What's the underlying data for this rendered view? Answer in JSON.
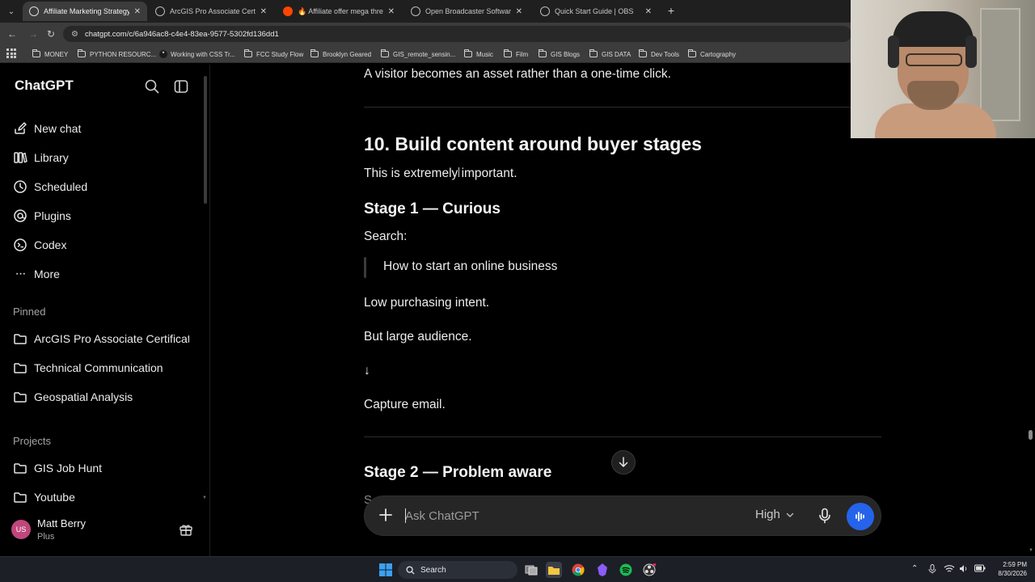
{
  "browser": {
    "tabs": [
      {
        "label": "Affiliate Marketing Strategy",
        "active": true,
        "favicon": "chatgpt-favicon"
      },
      {
        "label": "ArcGIS Pro Associate Certificatio",
        "active": false,
        "favicon": "chatgpt-favicon"
      },
      {
        "label": "🔥 Affiliate offer mega threa",
        "active": false,
        "favicon": "reddit-favicon"
      },
      {
        "label": "Open Broadcaster Software | O",
        "active": false,
        "favicon": "obs-favicon"
      },
      {
        "label": "Quick Start Guide | OBS",
        "active": false,
        "favicon": "obs-favicon"
      }
    ],
    "url": "chatgpt.com/c/6a946ac8-c4e4-83ea-9577-5302fd136dd1",
    "bookmarks": [
      "MONEY",
      "PYTHON RESOURC...",
      "Working with CSS Tr...",
      "FCC Study Flow",
      "Brooklyn Geared",
      "GIS_remote_sensin...",
      "Music",
      "Film",
      "GIS Blogs",
      "GIS DATA",
      "Dev Tools",
      "Cartography"
    ]
  },
  "sidebar": {
    "brand": "ChatGPT",
    "nav": [
      {
        "label": "New chat",
        "icon": "edit-icon"
      },
      {
        "label": "Library",
        "icon": "library-icon"
      },
      {
        "label": "Scheduled",
        "icon": "clock-icon"
      },
      {
        "label": "Plugins",
        "icon": "plugins-icon"
      },
      {
        "label": "Codex",
        "icon": "codex-icon"
      },
      {
        "label": "More",
        "icon": "more-icon"
      }
    ],
    "pinned_title": "Pinned",
    "pinned": [
      "ArcGIS Pro Associate Certificati",
      "Technical Communication",
      "Geospatial Analysis"
    ],
    "projects_title": "Projects",
    "projects": [
      "GIS Job Hunt",
      "Youtube"
    ],
    "user": {
      "initials": "US",
      "name": "Matt Berry",
      "plan": "Plus"
    }
  },
  "conversation": {
    "intro_line": "A visitor becomes an asset rather than a one-time click.",
    "heading": "10. Build content around buyer stages",
    "importance": "This is extremely important.",
    "stage1_heading": "Stage 1 — Curious",
    "search_label": "Search:",
    "quote": "How to start an online business",
    "line_intent": "Low purchasing intent.",
    "line_audience": "But large audience.",
    "arrow": "↓",
    "line_capture": "Capture email.",
    "stage2_heading": "Stage 2 — Problem aware",
    "cut_off_char": "S"
  },
  "composer": {
    "placeholder": "Ask ChatGPT",
    "model": "High"
  },
  "taskbar": {
    "search_label": "Search",
    "time": "2:59 PM",
    "date": "8/30/2026"
  }
}
